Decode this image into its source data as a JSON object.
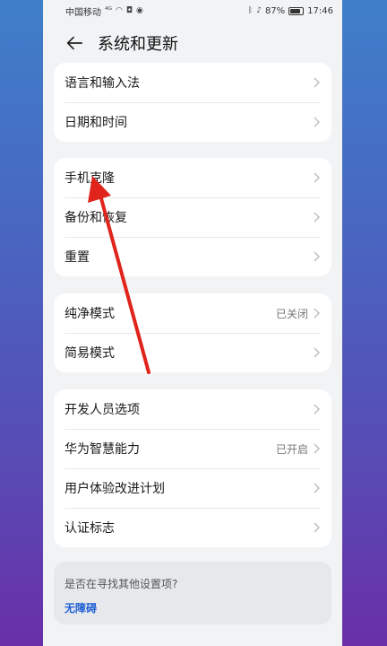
{
  "status_bar": {
    "carrier": "中国移动",
    "signal": "⁴ᴳ",
    "battery": "87%",
    "battery_level": 0.87,
    "time": "17:46"
  },
  "header": {
    "title": "系统和更新"
  },
  "groups": [
    {
      "items": [
        {
          "label": "语言和输入法",
          "value": ""
        },
        {
          "label": "日期和时间",
          "value": ""
        }
      ]
    },
    {
      "items": [
        {
          "label": "手机克隆",
          "value": ""
        },
        {
          "label": "备份和恢复",
          "value": ""
        },
        {
          "label": "重置",
          "value": ""
        }
      ]
    },
    {
      "items": [
        {
          "label": "纯净模式",
          "value": "已关闭"
        },
        {
          "label": "简易模式",
          "value": ""
        }
      ]
    },
    {
      "items": [
        {
          "label": "开发人员选项",
          "value": ""
        },
        {
          "label": "华为智慧能力",
          "value": "已开启"
        },
        {
          "label": "用户体验改进计划",
          "value": ""
        },
        {
          "label": "认证标志",
          "value": ""
        }
      ]
    }
  ],
  "tip": {
    "question": "是否在寻找其他设置项?",
    "link": "无障碍"
  },
  "annotation_color": "#e0241c"
}
